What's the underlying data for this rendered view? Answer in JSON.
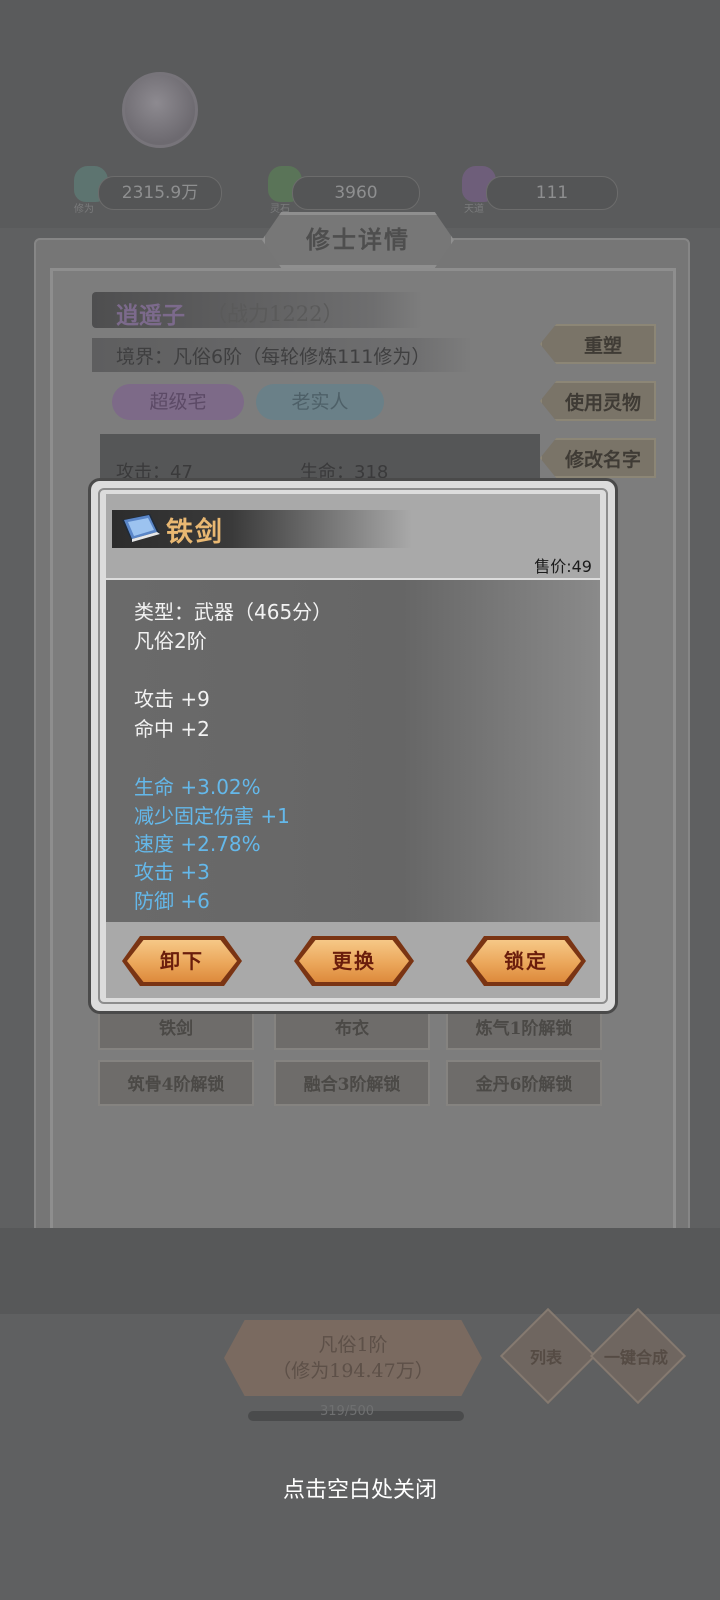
{
  "background": {
    "resources": [
      {
        "label": "修为",
        "value": "2315.9万"
      },
      {
        "label": "灵石",
        "value": "3960"
      },
      {
        "label": "天道",
        "value": "111"
      }
    ],
    "panel_title": "修士详情",
    "cultivator_name": "逍遥子",
    "combat_power": "（战力1222）",
    "realm_line": "境界：凡俗6阶（每轮修炼111修为）",
    "tags": [
      "超级宅",
      "老实人"
    ],
    "side_buttons": [
      "重塑",
      "使用灵物",
      "修改名字"
    ],
    "stats": [
      {
        "text": "攻击：47"
      },
      {
        "text": "生命：318"
      }
    ],
    "equipment_slots": [
      "铁剑",
      "布衣",
      "炼气1阶解锁",
      "筑骨4阶解锁",
      "融合3阶解锁",
      "金丹6阶解锁"
    ],
    "bottom_realm": {
      "line1": "凡俗1阶",
      "line2": "（修为194.47万）"
    },
    "diamond_buttons": [
      "列表",
      "一键合成"
    ],
    "progress_text": "319/500"
  },
  "modal": {
    "item_name": "铁剑",
    "price_label": "售价:49",
    "type_line": "类型：武器（465分）",
    "grade_line": "凡俗2阶",
    "base_stats": [
      "攻击 +9",
      "命中 +2"
    ],
    "extra_stats": [
      "生命 +3.02%",
      "减少固定伤害 +1",
      "速度 +2.78%",
      "攻击 +3",
      "防御 +6"
    ],
    "buttons": {
      "unequip": "卸下",
      "replace": "更换",
      "lock": "锁定"
    },
    "accent_color": "#64b8ea",
    "title_color": "#e9b872"
  },
  "close_hint": "点击空白处关闭"
}
